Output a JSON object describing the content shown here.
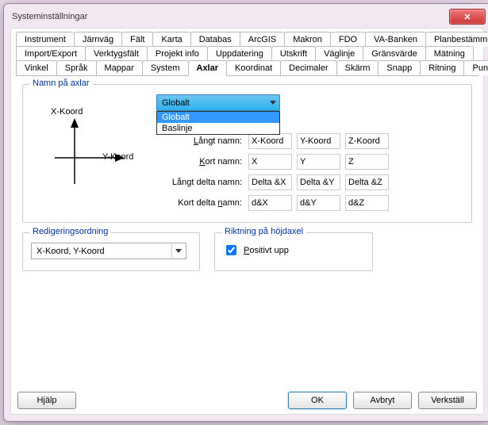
{
  "window": {
    "title": "Systeminställningar"
  },
  "tabs": {
    "row1": [
      "Instrument",
      "Järnväg",
      "Fält",
      "Karta",
      "Databas",
      "ArcGIS",
      "Makron",
      "FDO",
      "VA-Banken",
      "Planbestämmelser"
    ],
    "row2": [
      "Import/Export",
      "Verktygsfält",
      "Projekt info",
      "Uppdatering",
      "Utskrift",
      "Väglinje",
      "Gränsvärde",
      "Mätning"
    ],
    "row3": [
      "Vinkel",
      "Språk",
      "Mappar",
      "System",
      "Axlar",
      "Koordinat",
      "Decimaler",
      "Skärm",
      "Snapp",
      "Ritning",
      "Punktinfo"
    ],
    "active": "Axlar"
  },
  "group_axes": {
    "title": "Namn på axlar",
    "diagram_x": "X-Koord",
    "diagram_y": "Y-Koord",
    "dropdown_selected": "Globalt",
    "dropdown_options": [
      "Globalt",
      "Baslinje"
    ],
    "row_labels": {
      "long_name": "Långt namn:",
      "short_name": "Kort namn:",
      "long_delta": "Långt delta namn:",
      "short_delta": "Kort delta namn:"
    },
    "values": {
      "long": {
        "x": "X-Koord",
        "y": "Y-Koord",
        "z": "Z-Koord"
      },
      "short": {
        "x": "X",
        "y": "Y",
        "z": "Z"
      },
      "ldelta": {
        "x": "Delta &X",
        "y": "Delta &Y",
        "z": "Delta &Z"
      },
      "sdelta": {
        "x": "d&X",
        "y": "d&Y",
        "z": "d&Z"
      }
    }
  },
  "group_order": {
    "title": "Redigeringsordning",
    "value": "X-Koord, Y-Koord"
  },
  "group_dir": {
    "title": "Riktning på höjdaxel",
    "checkbox": "Positivt upp",
    "checked": true
  },
  "buttons": {
    "help": "Hjälp",
    "ok": "OK",
    "cancel": "Avbryt",
    "apply": "Verkställ"
  }
}
